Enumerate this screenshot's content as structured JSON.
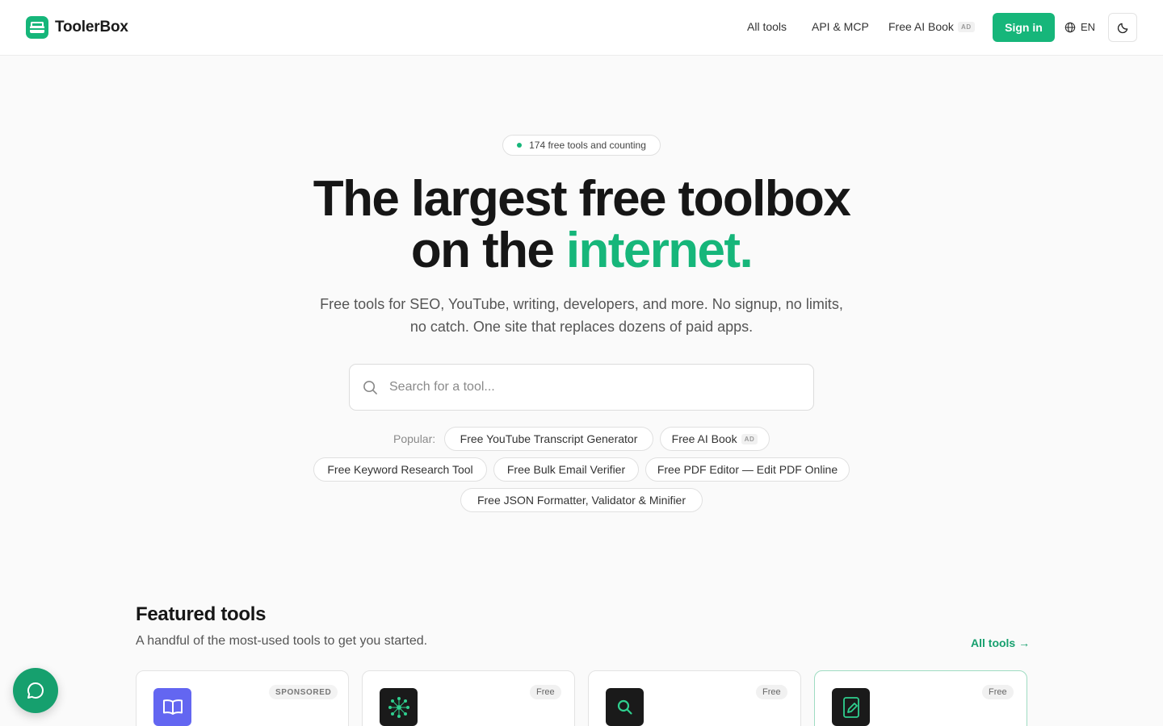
{
  "brand": {
    "name": "ToolerBox",
    "accent": "#16b67a"
  },
  "nav": {
    "all_tools": "All tools",
    "api_mcp": "API & MCP",
    "ai_book": "Free AI Book",
    "ad_label": "AD",
    "sign_in": "Sign in",
    "language": "EN",
    "icons": {
      "language": "globe-icon",
      "theme": "moon-icon"
    }
  },
  "hero": {
    "count_badge": "174 free tools and counting",
    "title_line1": "The largest free toolbox",
    "title_line2_prefix": "on the ",
    "title_line2_accent": "internet.",
    "subtitle": "Free tools for SEO, YouTube, writing, developers, and more. No signup, no limits, no catch. One site that replaces dozens of paid apps."
  },
  "search": {
    "value": "",
    "placeholder": "Search for a tool...",
    "icon": "search-icon"
  },
  "popular": {
    "label": "Popular:",
    "chips": [
      {
        "label": "Free YouTube Transcript Generator"
      },
      {
        "label": "Free AI Book",
        "ad": "AD"
      },
      {
        "label": "Free Keyword Research Tool"
      },
      {
        "label": "Free Bulk Email Verifier"
      },
      {
        "label": "Free PDF Editor — Edit PDF Online"
      },
      {
        "label": "Free JSON Formatter, Validator & Minifier"
      }
    ]
  },
  "featured": {
    "title": "Featured tools",
    "subtitle": "A handful of the most-used tools to get you started.",
    "all_tools_link": "All tools →",
    "cards": [
      {
        "badge": "SPONSORED",
        "icon": "book-icon",
        "tile_color": "#6366f1"
      },
      {
        "badge": "Free",
        "icon": "network-icon",
        "tile_color": "#1a1a1a"
      },
      {
        "badge": "Free",
        "icon": "magnifier-icon",
        "tile_color": "#1a1a1a"
      },
      {
        "badge": "Free",
        "icon": "pdf-edit-icon",
        "tile_color": "#1a1a1a"
      }
    ]
  },
  "chat": {
    "icon": "chat-bubble-icon"
  }
}
